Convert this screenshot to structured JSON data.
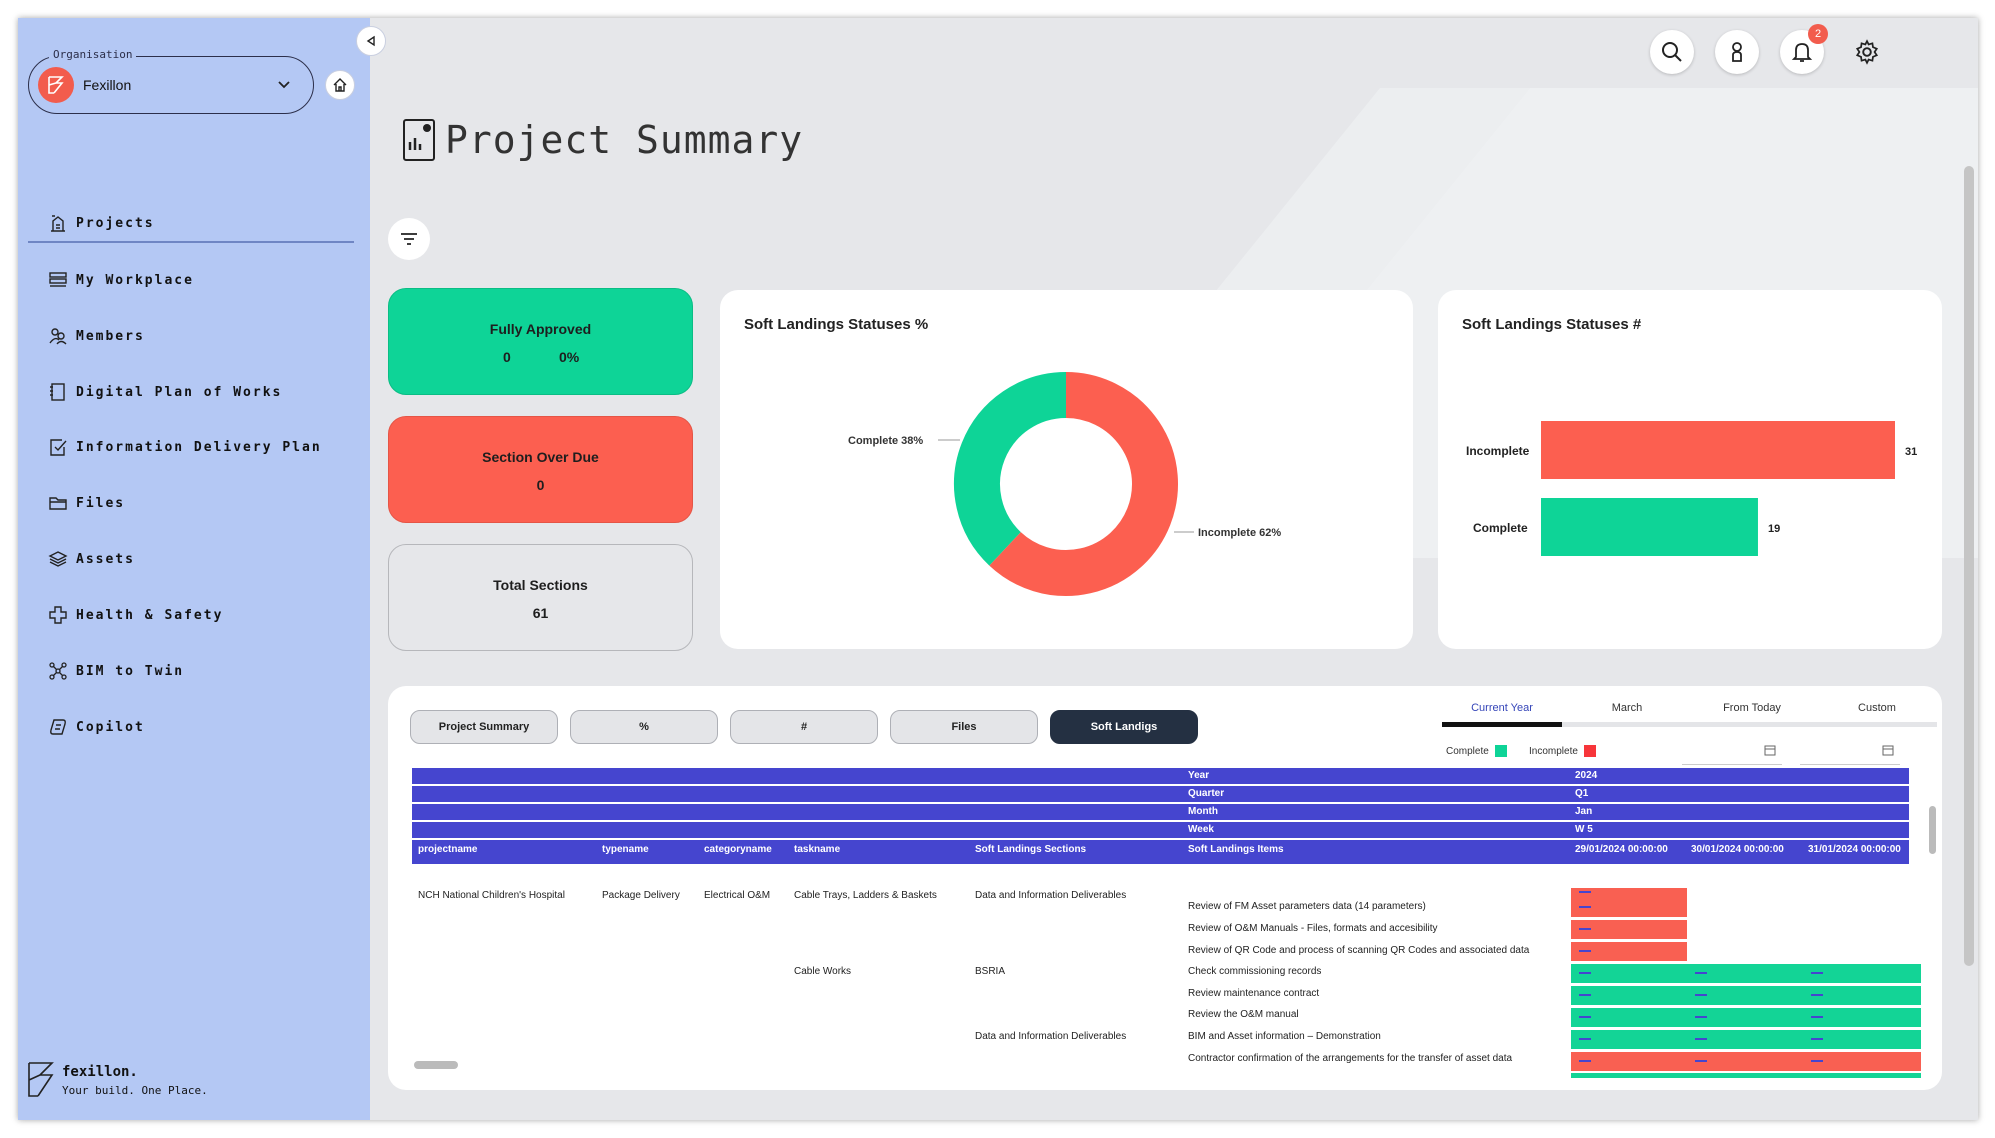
{
  "sidebar": {
    "org_label": "Organisation",
    "org_name": "Fexillon",
    "items": [
      {
        "label": "Projects",
        "icon": "projects-icon"
      },
      {
        "label": "My Workplace",
        "icon": "workplace-icon"
      },
      {
        "label": "Members",
        "icon": "members-icon"
      },
      {
        "label": "Digital Plan of Works",
        "icon": "plan-icon"
      },
      {
        "label": "Information Delivery Plan",
        "icon": "delivery-icon"
      },
      {
        "label": "Files",
        "icon": "folder-icon"
      },
      {
        "label": "Assets",
        "icon": "layers-icon"
      },
      {
        "label": "Health & Safety",
        "icon": "health-icon"
      },
      {
        "label": "BIM to Twin",
        "icon": "bim-icon"
      },
      {
        "label": "Copilot",
        "icon": "copilot-icon"
      }
    ],
    "brand_name": "fexillon.",
    "brand_tagline": "Your build. One Place."
  },
  "topbar": {
    "notification_count": "2"
  },
  "page": {
    "title": "Project Summary"
  },
  "kpis": {
    "approved": {
      "title": "Fully Approved",
      "count": "0",
      "percent": "0%"
    },
    "overdue": {
      "title": "Section Over Due",
      "count": "0"
    },
    "total": {
      "title": "Total Sections",
      "count": "61"
    }
  },
  "colors": {
    "complete": "#0ed497",
    "incomplete": "#fc5f50",
    "header": "#4545cf",
    "sidebar": "#b4c8f4"
  },
  "donut": {
    "title": "Soft Landings Statuses %",
    "complete_label": "Complete 38%",
    "incomplete_label": "Incomplete 62%"
  },
  "bars": {
    "title": "Soft Landings Statuses #",
    "incomplete_label": "Incomplete",
    "incomplete_value": "31",
    "complete_label": "Complete",
    "complete_value": "19"
  },
  "chart_data": [
    {
      "type": "pie",
      "title": "Soft Landings Statuses %",
      "categories": [
        "Complete",
        "Incomplete"
      ],
      "values": [
        38,
        62
      ]
    },
    {
      "type": "bar",
      "title": "Soft Landings Statuses #",
      "categories": [
        "Incomplete",
        "Complete"
      ],
      "values": [
        31,
        19
      ]
    }
  ],
  "tabs": [
    "Project Summary",
    "%",
    "#",
    "Files",
    "Soft Landigs"
  ],
  "period_tabs": [
    "Current Year",
    "March",
    "From Today",
    "Custom"
  ],
  "legend": {
    "complete": "Complete",
    "incomplete": "Incomplete"
  },
  "matrix": {
    "time_headers": [
      {
        "label": "Year",
        "value": "2024"
      },
      {
        "label": "Quarter",
        "value": "Q1"
      },
      {
        "label": "Month",
        "value": "Jan"
      },
      {
        "label": "Week",
        "value": "W 5"
      }
    ],
    "columns": [
      "projectname",
      "typename",
      "categoryname",
      "taskname",
      "Soft Landings Sections",
      "Soft Landings Items"
    ],
    "dates": [
      "29/01/2024 00:00:00",
      "30/01/2024 00:00:00",
      "31/01/2024 00:00:00"
    ],
    "project": "NCH National Children's Hospital",
    "typename": "Package Delivery",
    "category": "Electrical O&M",
    "task1": "Cable Trays, Ladders & Baskets",
    "task2": "Cable Works",
    "section1": "Data and Information Deliverables",
    "section2": "BSRIA",
    "section3": "Data and Information Deliverables",
    "items": [
      "Review of FM Asset parameters data (14 parameters)",
      "Review of O&M Manuals - Files, formats and accesibility",
      "Review of QR Code and process of scanning QR Codes and associated data",
      "Check commissioning records",
      "Review maintenance contract",
      "Review the O&M manual",
      "BIM and Asset information – Demonstration",
      "Contractor confirmation of the arrangements for the transfer of asset data"
    ]
  }
}
